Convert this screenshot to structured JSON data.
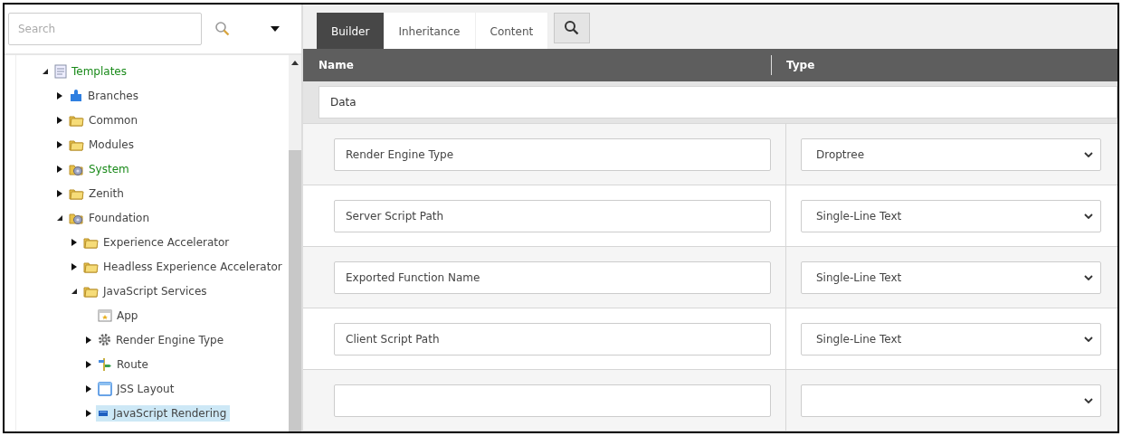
{
  "search": {
    "placeholder": "Search"
  },
  "tree": [
    {
      "label": "Templates",
      "kind": "template",
      "expanded": true,
      "color": "#1a8a1a",
      "selected": false,
      "children": [
        {
          "label": "Branches",
          "kind": "puzzle",
          "expanded": false,
          "color": "#444444",
          "selected": false
        },
        {
          "label": "Common",
          "kind": "folder",
          "expanded": false,
          "color": "#444444",
          "selected": false
        },
        {
          "label": "Modules",
          "kind": "folder",
          "expanded": false,
          "color": "#444444",
          "selected": false
        },
        {
          "label": "System",
          "kind": "gearfolder",
          "expanded": false,
          "color": "#1a8a1a",
          "selected": false
        },
        {
          "label": "Zenith",
          "kind": "folder",
          "expanded": false,
          "color": "#444444",
          "selected": false
        },
        {
          "label": "Foundation",
          "kind": "gearfolder",
          "expanded": true,
          "color": "#444444",
          "selected": false,
          "children": [
            {
              "label": "Experience Accelerator",
              "kind": "folder",
              "expanded": false,
              "color": "#444444",
              "selected": false
            },
            {
              "label": "Headless Experience Accelerator",
              "kind": "folder",
              "expanded": false,
              "color": "#444444",
              "selected": false
            },
            {
              "label": "JavaScript Services",
              "kind": "folder",
              "expanded": true,
              "color": "#444444",
              "selected": false,
              "children": [
                {
                  "label": "App",
                  "kind": "app",
                  "color": "#444444",
                  "selected": false
                },
                {
                  "label": "Render Engine Type",
                  "kind": "gear",
                  "expanded": false,
                  "color": "#444444",
                  "selected": false
                },
                {
                  "label": "Route",
                  "kind": "route",
                  "expanded": false,
                  "color": "#444444",
                  "selected": false
                },
                {
                  "label": "JSS Layout",
                  "kind": "window",
                  "expanded": false,
                  "color": "#444444",
                  "selected": false
                },
                {
                  "label": "JavaScript Rendering",
                  "kind": "rendering",
                  "expanded": false,
                  "color": "#444444",
                  "selected": true
                }
              ]
            }
          ]
        }
      ]
    }
  ],
  "tabs": [
    {
      "label": "Builder",
      "selected": true
    },
    {
      "label": "Inheritance",
      "selected": false
    },
    {
      "label": "Content",
      "selected": false
    }
  ],
  "table": {
    "columns": [
      "Name",
      "Type"
    ],
    "section": "Data",
    "rows": [
      {
        "name": "Render Engine Type",
        "type": "Droptree"
      },
      {
        "name": "Server Script Path",
        "type": "Single-Line Text"
      },
      {
        "name": "Exported Function Name",
        "type": "Single-Line Text"
      },
      {
        "name": "Client Script Path",
        "type": "Single-Line Text"
      },
      {}
    ]
  }
}
